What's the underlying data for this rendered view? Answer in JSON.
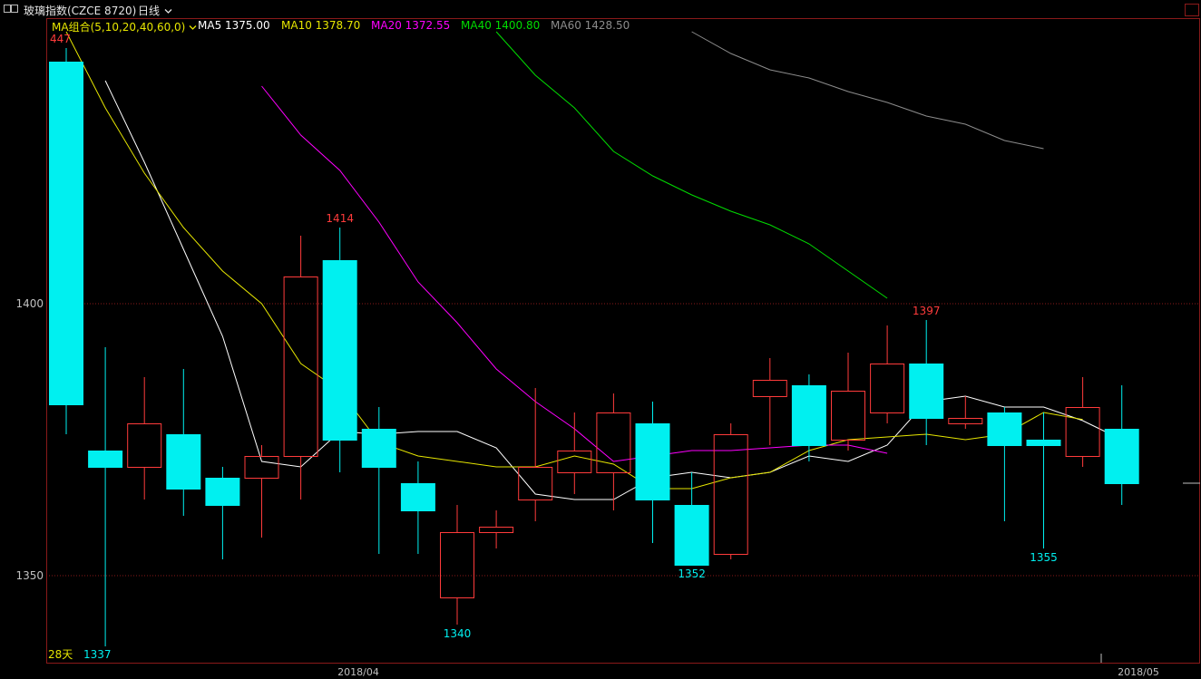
{
  "window": {
    "title": "玻璃指数(CZCE 8720)",
    "period": "日线",
    "period_arrow": "chevron-down-icon"
  },
  "legend": {
    "combo_label": "MA组合(5,10,20,40,60,0)",
    "ma5": "MA5 1375.00",
    "ma10": "MA10 1378.70",
    "ma20": "MA20 1372.55",
    "ma40": "MA40 1400.80",
    "ma60": "MA60 1428.50"
  },
  "days_label": "28天",
  "colors": {
    "background": "#000000",
    "up": "#ff3b3b",
    "down": "#00f0f0",
    "ma5": "#ffffff",
    "ma10": "#e6e600",
    "ma20": "#ff00ff",
    "ma40": "#00dd00",
    "ma60": "#8c8c8c",
    "grid": "#8a1a1a",
    "axis_text": "#c0c0c0",
    "combo": "#e6e600"
  },
  "chart_data": {
    "type": "candlestick",
    "title": "玻璃指数(CZCE 8720)",
    "ylim": [
      1335,
      1450
    ],
    "ytick_values": [
      1350,
      1400
    ],
    "ytick_labels": [
      "1400",
      "1350"
    ],
    "xtick_labels": [
      "2018/04",
      "2018/05"
    ],
    "grid": true,
    "candles": [
      {
        "open": 1444.5,
        "high": 1447,
        "low": 1376,
        "close": 1381.5,
        "dir": "down"
      },
      {
        "open": 1373,
        "high": 1392,
        "low": 1337,
        "close": 1370,
        "dir": "down"
      },
      {
        "open": 1370,
        "high": 1386.5,
        "low": 1364,
        "close": 1378,
        "dir": "up"
      },
      {
        "open": 1376,
        "high": 1388,
        "low": 1361,
        "close": 1366,
        "dir": "down"
      },
      {
        "open": 1368,
        "high": 1370,
        "low": 1353,
        "close": 1363,
        "dir": "down"
      },
      {
        "open": 1368,
        "high": 1374,
        "low": 1357,
        "close": 1372,
        "dir": "up"
      },
      {
        "open": 1372,
        "high": 1412.5,
        "low": 1364,
        "close": 1405,
        "dir": "up"
      },
      {
        "open": 1408,
        "high": 1414,
        "low": 1369,
        "close": 1375,
        "dir": "down"
      },
      {
        "open": 1377,
        "high": 1381,
        "low": 1354,
        "close": 1370,
        "dir": "down"
      },
      {
        "open": 1367,
        "high": 1371,
        "low": 1354,
        "close": 1362,
        "dir": "down"
      },
      {
        "open": 1346,
        "high": 1363,
        "low": 1341,
        "close": 1358,
        "dir": "up"
      },
      {
        "open": 1358,
        "high": 1362,
        "low": 1355,
        "close": 1359,
        "dir": "up"
      },
      {
        "open": 1364,
        "high": 1384.5,
        "low": 1360,
        "close": 1370,
        "dir": "up"
      },
      {
        "open": 1369,
        "high": 1380,
        "low": 1365,
        "close": 1373,
        "dir": "up"
      },
      {
        "open": 1369,
        "high": 1383.5,
        "low": 1362,
        "close": 1380,
        "dir": "up"
      },
      {
        "open": 1378,
        "high": 1382,
        "low": 1356,
        "close": 1364,
        "dir": "down"
      },
      {
        "open": 1363,
        "high": 1369,
        "low": 1352,
        "close": 1352,
        "dir": "down"
      },
      {
        "open": 1354,
        "high": 1378,
        "low": 1353,
        "close": 1376,
        "dir": "up"
      },
      {
        "open": 1383,
        "high": 1390,
        "low": 1374,
        "close": 1386,
        "dir": "up"
      },
      {
        "open": 1385,
        "high": 1387,
        "low": 1371,
        "close": 1374,
        "dir": "down"
      },
      {
        "open": 1375,
        "high": 1391,
        "low": 1373,
        "close": 1384,
        "dir": "up"
      },
      {
        "open": 1380,
        "high": 1396,
        "low": 1378,
        "close": 1389,
        "dir": "up"
      },
      {
        "open": 1389,
        "high": 1397,
        "low": 1374,
        "close": 1379,
        "dir": "down"
      },
      {
        "open": 1378,
        "high": 1383,
        "low": 1377,
        "close": 1379,
        "dir": "up"
      },
      {
        "open": 1380,
        "high": 1381,
        "low": 1360,
        "close": 1374,
        "dir": "down"
      },
      {
        "open": 1375,
        "high": 1380,
        "low": 1355,
        "close": 1374,
        "dir": "down"
      },
      {
        "open": 1372,
        "high": 1386.5,
        "low": 1370,
        "close": 1381,
        "dir": "up"
      },
      {
        "open": 1377,
        "high": 1385,
        "low": 1363,
        "close": 1367,
        "dir": "down"
      }
    ],
    "labels": [
      {
        "index": 0,
        "value": 1447,
        "text": "447",
        "color": "up"
      },
      {
        "index": 1,
        "value": 1337,
        "text": "1337",
        "color": "down"
      },
      {
        "index": 7,
        "value": 1414,
        "text": "1414",
        "color": "up"
      },
      {
        "index": 10,
        "value": 1341,
        "text": "1340",
        "color": "down"
      },
      {
        "index": 16,
        "value": 1352,
        "text": "1352",
        "color": "down"
      },
      {
        "index": 22,
        "value": 1397,
        "text": "1397",
        "color": "up"
      },
      {
        "index": 25,
        "value": 1355,
        "text": "1355",
        "color": "down"
      }
    ],
    "series": [
      {
        "name": "MA5",
        "color": "ma5",
        "start": 1,
        "values": [
          1441,
          1426,
          1410,
          1394,
          1371,
          1370,
          1376.5,
          1376,
          1376.5,
          1376.5,
          1373.5,
          1365,
          1364,
          1364,
          1368,
          1369,
          1368,
          1369,
          1372,
          1371,
          1374,
          1382,
          1383,
          1381,
          1381,
          1378.5,
          1375
        ]
      },
      {
        "name": "MA10",
        "color": "ma10",
        "start": 0,
        "values": [
          1450,
          1436,
          1424,
          1414,
          1406,
          1400,
          1389,
          1384,
          1374.5,
          1372,
          1371,
          1370,
          1370,
          1372,
          1370.5,
          1366,
          1366,
          1368,
          1369,
          1373,
          1375,
          1375.5,
          1376,
          1375,
          1376,
          1380,
          1378.7
        ]
      },
      {
        "name": "MA20",
        "color": "ma20",
        "start": 5,
        "values": [
          1440,
          1431,
          1424.5,
          1415,
          1404,
          1396.5,
          1388,
          1382,
          1377,
          1371,
          1372,
          1373,
          1373,
          1373.5,
          1374,
          1374,
          1372.5
        ]
      },
      {
        "name": "MA40",
        "color": "ma40",
        "start": 11,
        "values": [
          1450,
          1442,
          1436,
          1428,
          1423.5,
          1420,
          1417,
          1414.5,
          1411,
          1406,
          1401
        ]
      },
      {
        "name": "MA60",
        "color": "ma60",
        "start": 16,
        "values": [
          1450,
          1446,
          1443,
          1441.5,
          1439,
          1437,
          1434.5,
          1433,
          1430,
          1428.5
        ]
      }
    ],
    "current_price_marker": 1367
  }
}
